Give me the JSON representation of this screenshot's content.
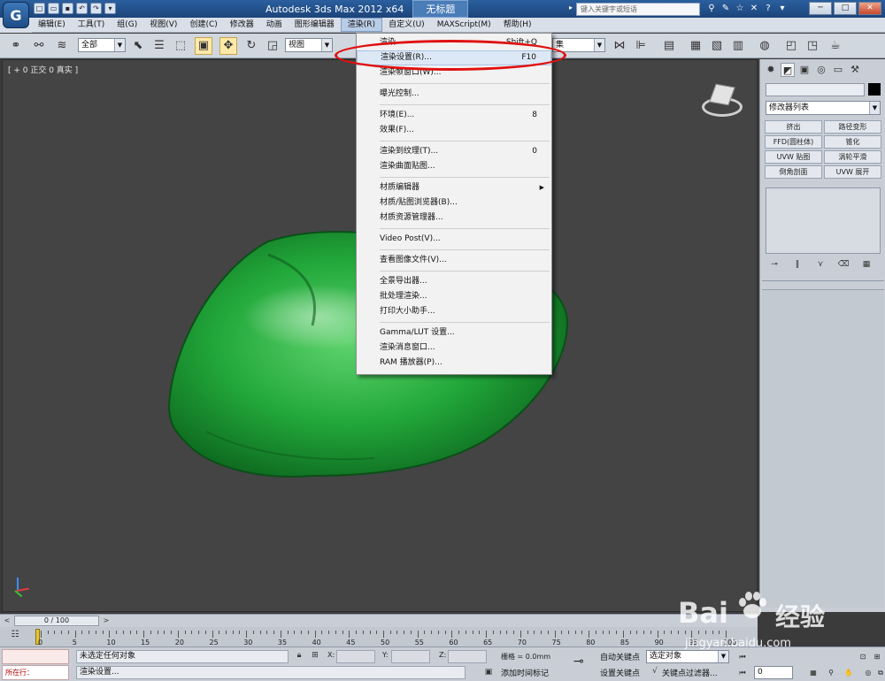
{
  "title_bar": {
    "app_title": "Autodesk 3ds Max  2012 x64",
    "document": "无标题",
    "search_placeholder": "键入关键字或短语",
    "logo_glyph": "G"
  },
  "menu": [
    "编辑(E)",
    "工具(T)",
    "组(G)",
    "视图(V)",
    "创建(C)",
    "修改器",
    "动画",
    "图形编辑器",
    "渲染(R)",
    "自定义(U)",
    "MAXScript(M)",
    "帮助(H)"
  ],
  "toolbar": {
    "selection_filter": "全部",
    "ref_coord": "视图",
    "named_selection": "集"
  },
  "viewport": {
    "label": "[ + 0 正交 0 真实 ]"
  },
  "render_menu": {
    "groups": [
      [
        {
          "label": "渲染",
          "shortcut": "Shift+Q"
        },
        {
          "label": "渲染设置(R)...",
          "shortcut": "F10",
          "highlighted": true
        },
        {
          "label": "渲染帧窗口(W)...",
          "shortcut": ""
        }
      ],
      [
        {
          "label": "曝光控制...",
          "shortcut": ""
        }
      ],
      [
        {
          "label": "环境(E)...",
          "shortcut": "8"
        },
        {
          "label": "效果(F)...",
          "shortcut": ""
        }
      ],
      [
        {
          "label": "渲染到纹理(T)...",
          "shortcut": "0"
        },
        {
          "label": "渲染曲面贴图...",
          "shortcut": ""
        }
      ],
      [
        {
          "label": "材质编辑器",
          "shortcut": "",
          "submenu": true
        },
        {
          "label": "材质/贴图浏览器(B)...",
          "shortcut": ""
        },
        {
          "label": "材质资源管理器...",
          "shortcut": ""
        }
      ],
      [
        {
          "label": "Video Post(V)...",
          "shortcut": ""
        }
      ],
      [
        {
          "label": "查看图像文件(V)...",
          "shortcut": ""
        }
      ],
      [
        {
          "label": "全景导出器...",
          "shortcut": ""
        },
        {
          "label": "批处理渲染...",
          "shortcut": ""
        },
        {
          "label": "打印大小助手...",
          "shortcut": ""
        }
      ],
      [
        {
          "label": "Gamma/LUT 设置...",
          "shortcut": ""
        },
        {
          "label": "渲染消息窗口...",
          "shortcut": ""
        },
        {
          "label": "RAM 播放器(P)...",
          "shortcut": ""
        }
      ]
    ]
  },
  "command_panel": {
    "modifier_list": "修改器列表",
    "modifiers": [
      "挤出",
      "路径变形",
      "FFD(圆柱体)",
      "锥化",
      "UVW 贴图",
      "涡轮平滑",
      "倒角剖面",
      "UVW 展开"
    ]
  },
  "timeline": {
    "thumb_label": "0 / 100",
    "ticks": [
      "0",
      "5",
      "10",
      "15",
      "20",
      "25",
      "30",
      "35",
      "40",
      "45",
      "50",
      "55",
      "60",
      "65",
      "70",
      "75",
      "80",
      "85",
      "90",
      "95",
      "100"
    ]
  },
  "status": {
    "running_label": "所在行：",
    "selection_msg": "未选定任何对象",
    "prompt_msg": "渲染设置...",
    "x_label": "X:",
    "y_label": "Y:",
    "z_label": "Z:",
    "grid": "栅格 = 0.0mm",
    "auto_key": "自动关键点",
    "set_key": "设置关键点",
    "key_mode": "选定对象",
    "key_filters": "关键点过滤器...",
    "add_time_tag": "添加时间标记",
    "frame": "0"
  },
  "watermark": {
    "brand_text": "Bai",
    "brand_text_cn": "经验",
    "url": "jingyan.baidu.com"
  },
  "colors": {
    "stone": "#22a83a",
    "annotation": "#e01010"
  }
}
